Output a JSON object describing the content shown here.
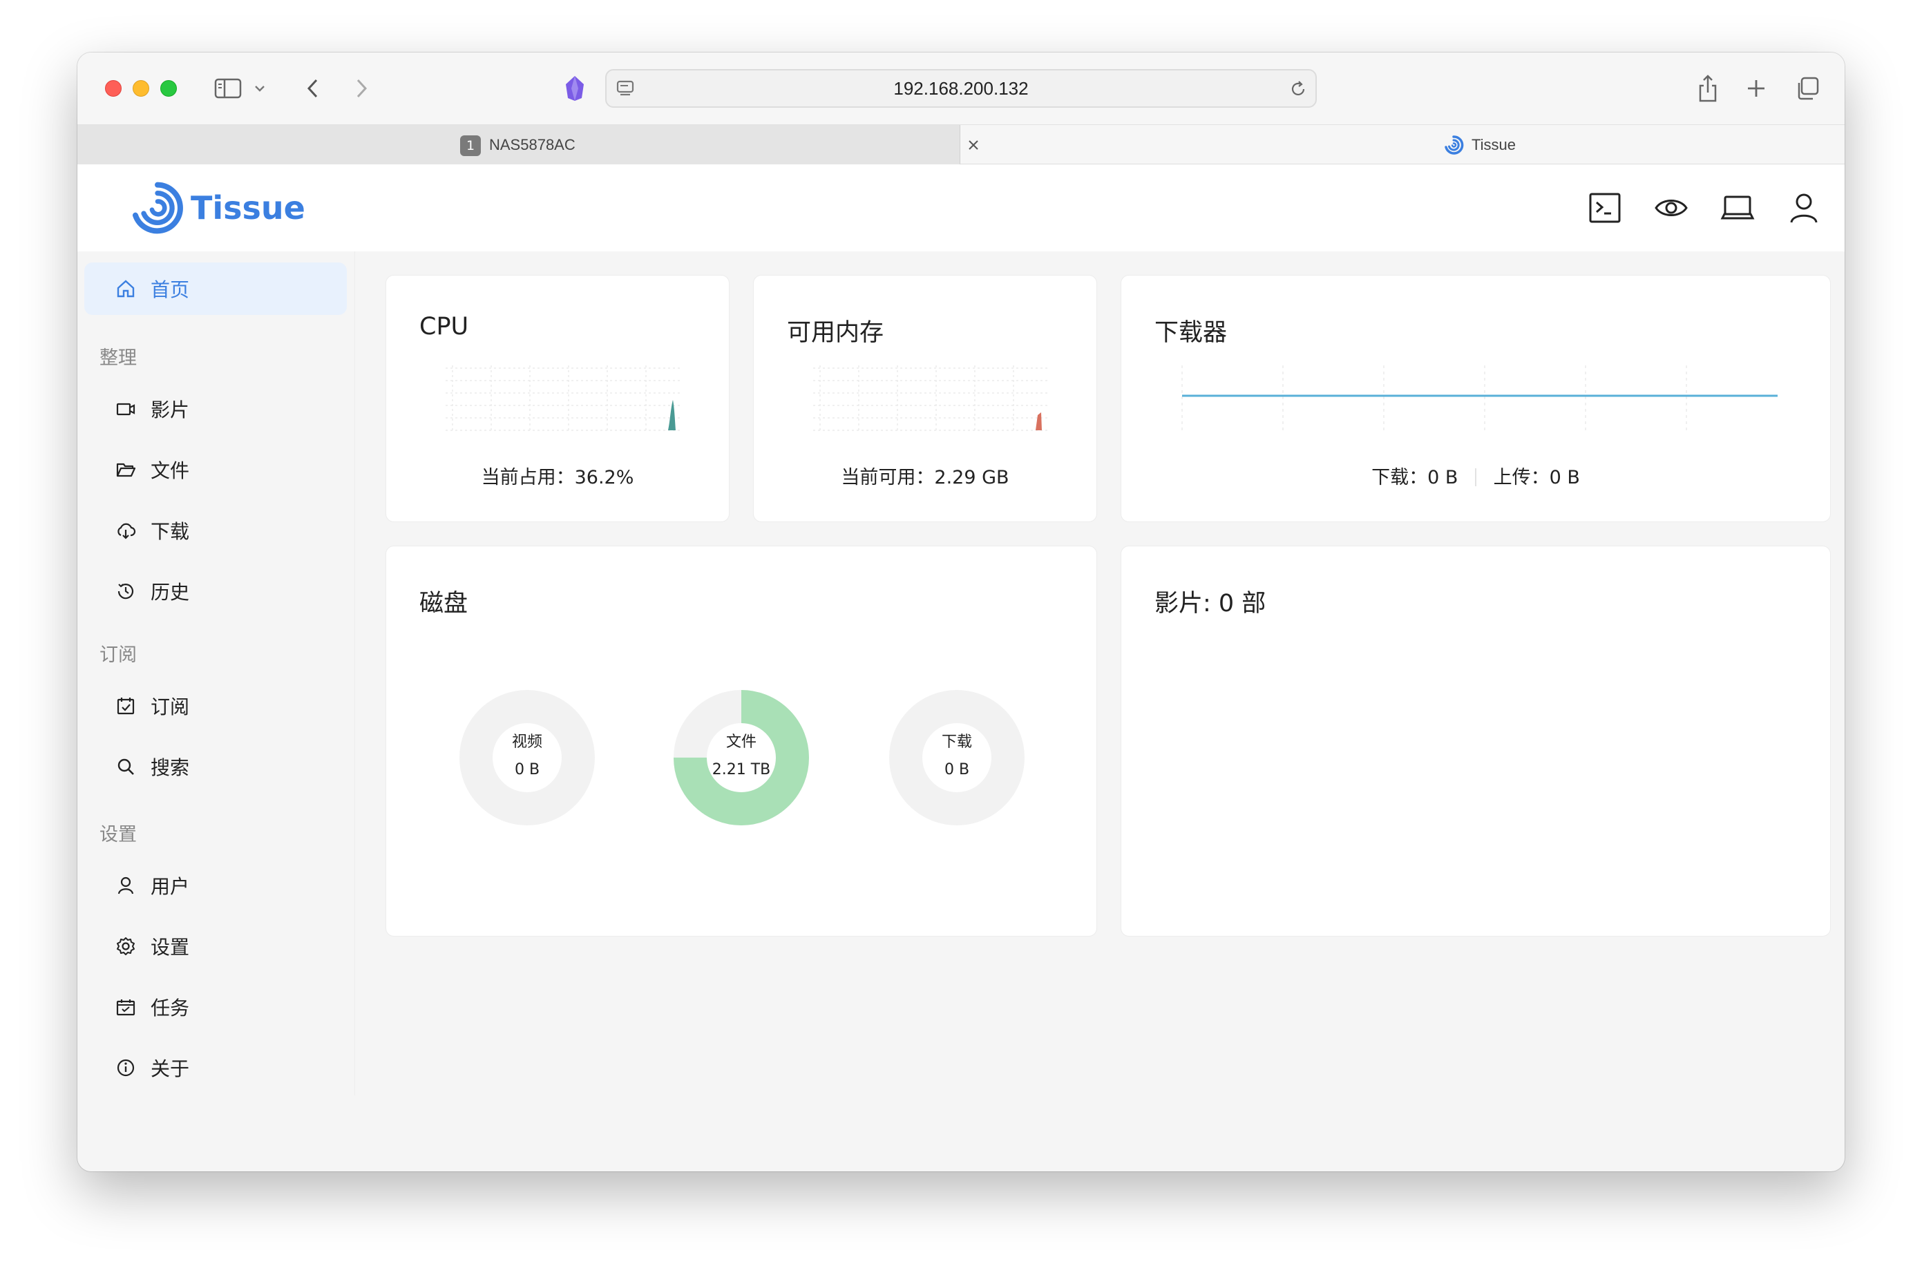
{
  "browser": {
    "url": "192.168.200.132",
    "tabs": [
      {
        "number": "1",
        "label": "NAS5878AC",
        "active": false
      },
      {
        "label": "Tissue",
        "active": true
      }
    ]
  },
  "app": {
    "brand": "Tissue",
    "brand_color": "#3b7fe0",
    "header_icons": [
      "terminal-icon",
      "eye-icon",
      "laptop-icon",
      "user-icon"
    ]
  },
  "sidebar": {
    "home": "首页",
    "groups": [
      {
        "title": "整理",
        "items": [
          {
            "label": "影片",
            "icon": "video-icon"
          },
          {
            "label": "文件",
            "icon": "folder-icon"
          },
          {
            "label": "下载",
            "icon": "cloud-download-icon"
          },
          {
            "label": "历史",
            "icon": "history-icon"
          }
        ]
      },
      {
        "title": "订阅",
        "items": [
          {
            "label": "订阅",
            "icon": "calendar-check-icon"
          },
          {
            "label": "搜索",
            "icon": "search-icon"
          }
        ]
      },
      {
        "title": "设置",
        "items": [
          {
            "label": "用户",
            "icon": "user-icon"
          },
          {
            "label": "设置",
            "icon": "gear-icon"
          },
          {
            "label": "任务",
            "icon": "task-icon"
          },
          {
            "label": "关于",
            "icon": "info-icon"
          }
        ]
      }
    ]
  },
  "cards": {
    "cpu": {
      "title": "CPU",
      "footer": "当前占用：36.2%",
      "value_percent": 36.2,
      "color": "#4a9a94"
    },
    "memory": {
      "title": "可用内存",
      "footer": "当前可用：2.29 GB",
      "color": "#d9715f"
    },
    "downloader": {
      "title": "下载器",
      "download_label": "下载：0 B",
      "upload_label": "上传：0 B",
      "line_color": "#5ab0d8"
    },
    "disk": {
      "title": "磁盘",
      "donuts": [
        {
          "label": "视频",
          "value": "0 B",
          "fraction": 0
        },
        {
          "label": "文件",
          "value": "2.21 TB",
          "fraction": 0.75
        },
        {
          "label": "下载",
          "value": "0 B",
          "fraction": 0
        }
      ],
      "fill_color": "#a9e0b6",
      "track_color": "#f2f2f2"
    },
    "movies": {
      "title": "影片: 0 部"
    }
  }
}
